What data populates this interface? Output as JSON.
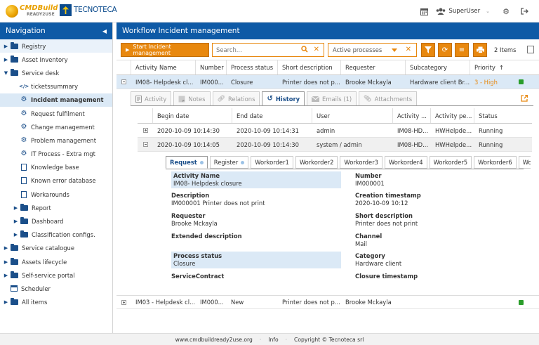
{
  "header": {
    "logo1_text": "CMDBuild",
    "logo1_sub": "READY2USE",
    "logo2_text": "TECNOTECA",
    "user": "SuperUser"
  },
  "nav": {
    "title": "Navigation",
    "items": [
      {
        "label": "Registry",
        "icon": "folder-icon",
        "arrow": "▶",
        "indent": 0,
        "state": "hi"
      },
      {
        "label": "Asset Inventory",
        "icon": "folder-icon",
        "arrow": "▶",
        "indent": 0,
        "state": ""
      },
      {
        "label": "Service desk",
        "icon": "folder-icon",
        "arrow": "▼",
        "indent": 0,
        "state": ""
      },
      {
        "label": "ticketssummary",
        "icon": "code-icon",
        "arrow": "",
        "indent": 1,
        "state": ""
      },
      {
        "label": "Incident management",
        "icon": "gear-icon",
        "arrow": "",
        "indent": 1,
        "state": "sel"
      },
      {
        "label": "Request fulfilment",
        "icon": "gear-icon",
        "arrow": "",
        "indent": 1,
        "state": ""
      },
      {
        "label": "Change management",
        "icon": "gear-icon",
        "arrow": "",
        "indent": 1,
        "state": ""
      },
      {
        "label": "Problem management",
        "icon": "gear-icon",
        "arrow": "",
        "indent": 1,
        "state": ""
      },
      {
        "label": "IT Process - Extra mgt",
        "icon": "gear-icon",
        "arrow": "",
        "indent": 1,
        "state": ""
      },
      {
        "label": "Knowledge base",
        "icon": "doc-icon",
        "arrow": "",
        "indent": 1,
        "state": ""
      },
      {
        "label": "Known error database",
        "icon": "doc-icon",
        "arrow": "",
        "indent": 1,
        "state": ""
      },
      {
        "label": "Workarounds",
        "icon": "doc-icon",
        "arrow": "",
        "indent": 1,
        "state": ""
      },
      {
        "label": "Report",
        "icon": "folder-icon",
        "arrow": "▶",
        "indent": 1,
        "state": ""
      },
      {
        "label": "Dashboard",
        "icon": "folder-icon",
        "arrow": "▶",
        "indent": 1,
        "state": ""
      },
      {
        "label": "Classification configs.",
        "icon": "folder-icon",
        "arrow": "▶",
        "indent": 1,
        "state": ""
      },
      {
        "label": "Service catalogue",
        "icon": "folder-icon",
        "arrow": "▶",
        "indent": 0,
        "state": ""
      },
      {
        "label": "Assets lifecycle",
        "icon": "folder-icon",
        "arrow": "▶",
        "indent": 0,
        "state": ""
      },
      {
        "label": "Self-service portal",
        "icon": "folder-icon",
        "arrow": "▶",
        "indent": 0,
        "state": ""
      },
      {
        "label": "Scheduler",
        "icon": "calendar-icon",
        "arrow": "",
        "indent": 0,
        "state": ""
      },
      {
        "label": "All items",
        "icon": "folder-icon",
        "arrow": "▶",
        "indent": 0,
        "state": ""
      }
    ]
  },
  "main": {
    "title": "Workflow Incident management",
    "start_button": "Start Incident management",
    "search_placeholder": "Search...",
    "filter_value": "Active processes",
    "items_count": "2 Items",
    "columns": [
      "Activity Name",
      "Number",
      "Process status",
      "Short description",
      "Requester",
      "Subcategory",
      "Priority"
    ],
    "rows": [
      {
        "activity": "IM08- Helpdesk cl...",
        "number": "IM000...",
        "status": "Closure",
        "short": "Printer does not p...",
        "requester": "Brooke Mckayla",
        "subcategory": "Hardware client Br...",
        "priority": "3 - High"
      },
      {
        "activity": "IM03 - Helpdesk cl...",
        "number": "IM000...",
        "status": "New",
        "short": "Printer does not p...",
        "requester": "Brooke Mckayla",
        "subcategory": "",
        "priority": ""
      }
    ],
    "sort_arrow": "↑",
    "status_color": "#2a9d2a"
  },
  "detail": {
    "tabs": [
      "Activity",
      "Notes",
      "Relations",
      "History",
      "Emails (1)",
      "Attachments"
    ],
    "history_columns": [
      "Begin date",
      "End date",
      "User",
      "Activity ...",
      "Activity pe...",
      "Status"
    ],
    "history_rows": [
      {
        "begin": "2020-10-09 10:14:30",
        "end": "2020-10-09 10:14:31",
        "user": "admin",
        "activity": "IM08-HD...",
        "performer": "HWHelpde...",
        "status": "Running"
      },
      {
        "begin": "2020-10-09 10:14:05",
        "end": "2020-10-09 10:14:30",
        "user": "system / admin",
        "activity": "IM08-HD...",
        "performer": "HWHelpde...",
        "status": "Running"
      }
    ],
    "step_tabs": [
      "Request",
      "Register",
      "Workorder1",
      "Workorder2",
      "Workorder3",
      "Workorder4",
      "Workorder5",
      "Workorder6",
      "Work"
    ],
    "fields": {
      "activity_name_label": "Activity Name",
      "activity_name_value": "IM08- Helpdesk closure",
      "number_label": "Number",
      "number_value": "IM000001",
      "description_label": "Description",
      "description_value": "IM000001 Printer does not print",
      "creation_label": "Creation timestamp",
      "creation_value": "2020-10-09 10:12",
      "requester_label": "Requester",
      "requester_value": "Brooke Mckayla",
      "short_label": "Short description",
      "short_value": "Printer does not print",
      "extended_label": "Extended description",
      "channel_label": "Channel",
      "channel_value": "Mail",
      "process_status_label": "Process status",
      "process_status_value": "Closure",
      "category_label": "Category",
      "category_value": "Hardware client",
      "service_contract_label": "ServiceContract",
      "closure_label": "Closure timestamp"
    }
  },
  "footer": {
    "site": "www.cmdbuildready2use.org",
    "info": "Info",
    "copyright": "Copyright © Tecnoteca srl"
  }
}
